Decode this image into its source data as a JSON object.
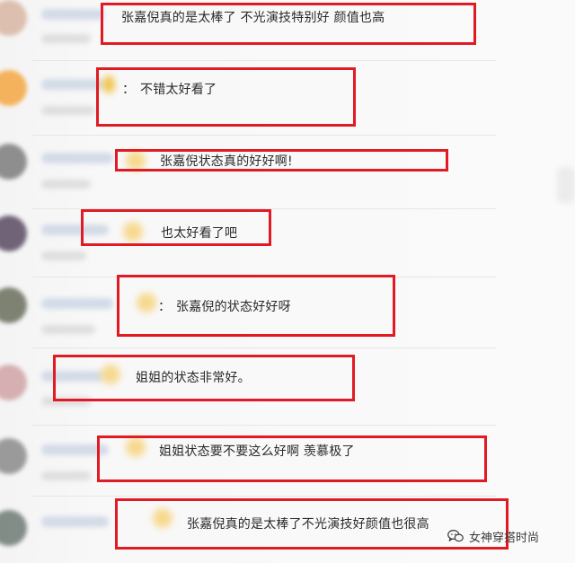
{
  "comments": [
    {
      "text": "张嘉倪真的是太棒了 不光演技特别好 颜值也高"
    },
    {
      "text": "不错太好看了",
      "colon": "："
    },
    {
      "text": "张嘉倪状态真的好好啊!"
    },
    {
      "text": "也太好看了吧"
    },
    {
      "text": "张嘉倪的状态好好呀",
      "colon": "："
    },
    {
      "text": "姐姐的状态非常好。"
    },
    {
      "text": "姐姐状态要不要这么好啊 羡慕极了"
    },
    {
      "text": "张嘉倪真的是太棒了不光演技好颜值也很高"
    }
  ],
  "watermark": {
    "icon": "wechat-icon",
    "text": "女神穿搭时尚"
  },
  "colors": {
    "highlight_box": "#e01b24",
    "background": "#f7f7f7"
  }
}
